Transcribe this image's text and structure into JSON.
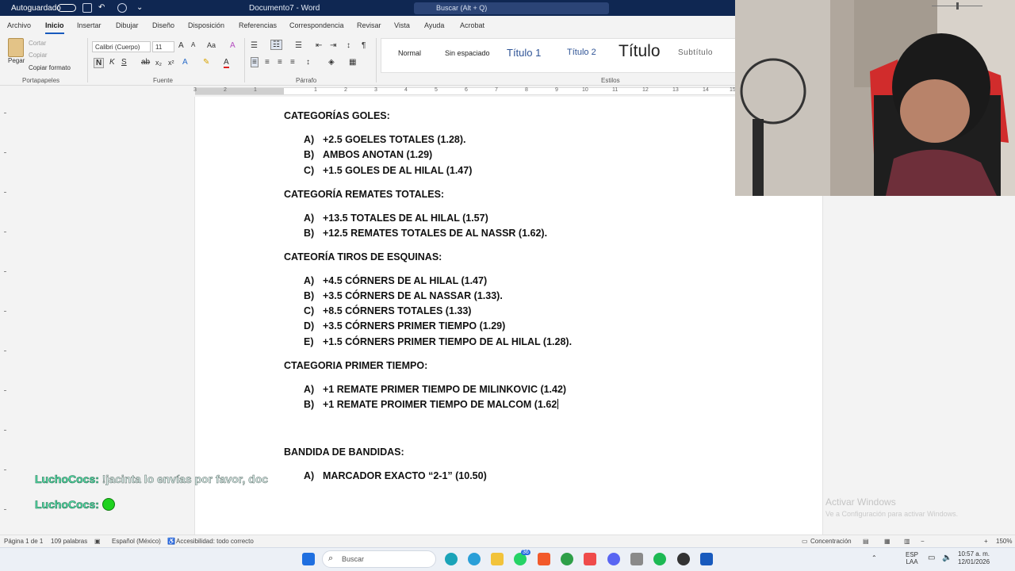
{
  "titlebar": {
    "autosave_label": "Autoguardado",
    "doc_name": "Documento7 - Word",
    "search_placeholder": "Buscar (Alt + Q)"
  },
  "ribbon": {
    "tabs": [
      "Archivo",
      "Inicio",
      "Insertar",
      "Dibujar",
      "Diseño",
      "Disposición",
      "Referencias",
      "Correspondencia",
      "Revisar",
      "Vista",
      "Ayuda",
      "Acrobat"
    ],
    "active_tab": "Inicio",
    "clipboard": {
      "paste": "Pegar",
      "cut": "Cortar",
      "copy": "Copiar",
      "format_painter": "Copiar formato",
      "group": "Portapapeles"
    },
    "font": {
      "name": "Calibri (Cuerpo)",
      "size": "11",
      "bold": "N",
      "italic": "K",
      "underline": "S",
      "group": "Fuente"
    },
    "paragraph": {
      "group": "Párrafo"
    },
    "styles": {
      "items": [
        "Normal",
        "Sin espaciado",
        "Título 1",
        "Título 2",
        "Título",
        "Subtítulo"
      ],
      "group": "Estilos"
    }
  },
  "ruler": {
    "numbers": [
      "3",
      "2",
      "1",
      "1",
      "2",
      "3",
      "4",
      "5",
      "6",
      "7",
      "8",
      "9",
      "10",
      "11",
      "12",
      "13",
      "14",
      "15"
    ]
  },
  "document": {
    "sections": [
      {
        "heading": "CATEGORÍAS GOLES:",
        "items": [
          {
            "marker": "A)",
            "text": "+2.5 GOELES TOTALES (1.28)."
          },
          {
            "marker": "B)",
            "text": "AMBOS ANOTAN (1.29)"
          },
          {
            "marker": "C)",
            "text": "+1.5 GOLES DE AL HILAL (1.47)"
          }
        ]
      },
      {
        "heading": "CATEGORÍA REMATES TOTALES:",
        "items": [
          {
            "marker": "A)",
            "text": "+13.5 TOTALES DE AL HILAL (1.57)"
          },
          {
            "marker": "B)",
            "text": "+12.5 REMATES TOTALES DE AL NASSR (1.62)."
          }
        ]
      },
      {
        "heading": "CATEORÍA TIROS DE ESQUINAS:",
        "items": [
          {
            "marker": "A)",
            "text": "+4.5 CÓRNERS DE AL HILAL (1.47)"
          },
          {
            "marker": "B)",
            "text": "+3.5 CÓRNERS DE AL NASSAR (1.33)."
          },
          {
            "marker": "C)",
            "text": "+8.5 CÓRNERS TOTALES (1.33)"
          },
          {
            "marker": "D)",
            "text": "+3.5 CÓRNERS PRIMER TIEMPO (1.29)"
          },
          {
            "marker": "E)",
            "text": "+1.5 CÓRNERS PRIMER TIEMPO DE AL HILAL (1.28)."
          }
        ]
      },
      {
        "heading": "CTAEGORIA PRIMER TIEMPO:",
        "items": [
          {
            "marker": "A)",
            "text": "+1 REMATE PRIMER TIEMPO DE MILINKOVIC (1.42)"
          },
          {
            "marker": "B)",
            "text": "+1 REMATE PROIMER TIEMPO DE MALCOM (1.62"
          }
        ]
      },
      {
        "heading": "BANDIDA DE BANDIDAS:",
        "items": [
          {
            "marker": "A)",
            "text": "MARCADOR EXACTO “2-1” (10.50)"
          }
        ]
      }
    ]
  },
  "chat": [
    {
      "user": "LuchoCocs:",
      "message": "!jacinta lo envías por favor, doc"
    },
    {
      "user": "LuchoCocs:",
      "message": ""
    }
  ],
  "activation": {
    "title": "Activar Windows",
    "subtitle": "Ve a Configuración para activar Windows."
  },
  "statusbar": {
    "page": "Página 1 de 1",
    "words": "109 palabras",
    "language": "Español (México)",
    "accessibility": "Accesibilidad: todo correcto",
    "focus": "Concentración",
    "zoom": "150%",
    "zoom_level": 0.5
  },
  "taskbar": {
    "search": "Buscar",
    "whatsapp_badge": "36",
    "lang": "ESP",
    "lang2": "LAA",
    "time": "10:57 a. m.",
    "date": "12/01/2026"
  },
  "colors": {
    "word_blue": "#185abd",
    "titlebar": "#0f2752",
    "chat_user": "#57e6ad"
  }
}
